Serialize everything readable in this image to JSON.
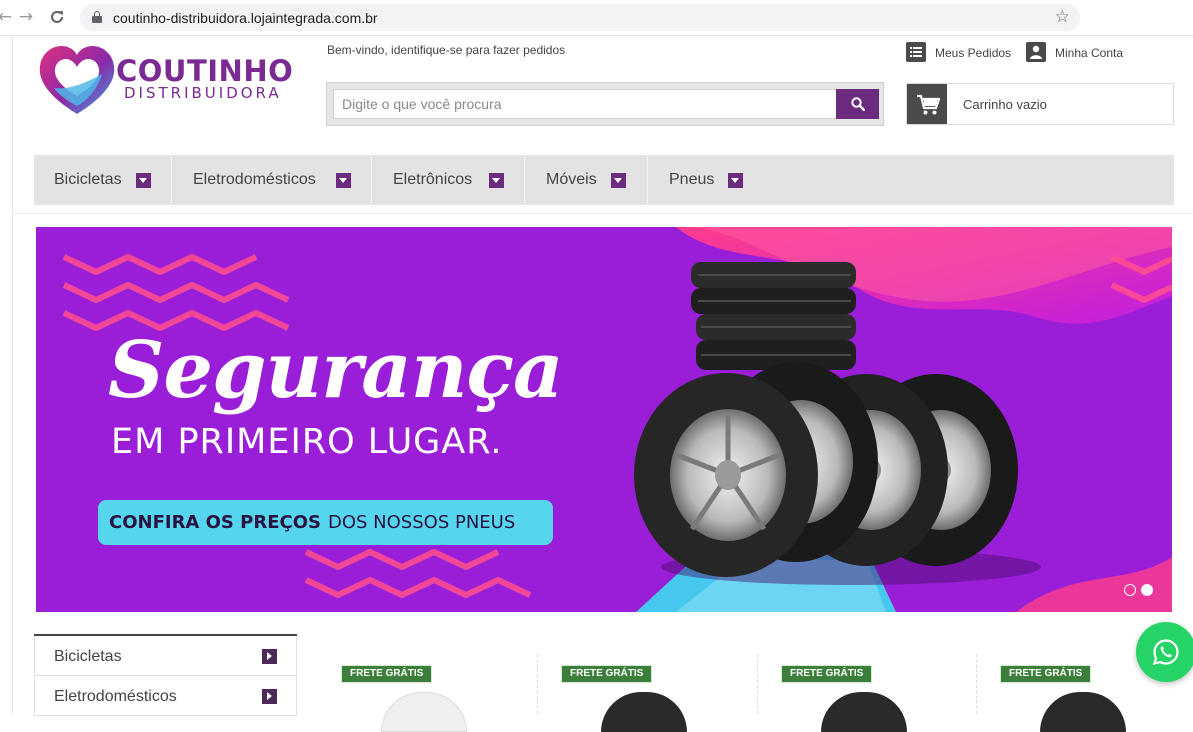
{
  "browser": {
    "url": "coutinho-distribuidora.lojaintegrada.com.br",
    "back_icon": "arrow-left-icon",
    "forward_icon": "arrow-right-icon",
    "reload_icon": "reload-icon",
    "bookmark_icon": "star-icon"
  },
  "header": {
    "logo_name": "COUTINHO",
    "logo_sub": "DISTRIBUIDORA",
    "welcome": "Bem-vindo, identifique-se para fazer pedidos",
    "search_placeholder": "Digite o que você procura",
    "search_value": "",
    "orders_link": "Meus Pedidos",
    "account_link": "Minha Conta",
    "cart_label": "Carrinho vazio"
  },
  "menu": {
    "items": [
      {
        "label": "Bicicletas"
      },
      {
        "label": "Eletrodomésticos"
      },
      {
        "label": "Eletrônicos"
      },
      {
        "label": "Móveis"
      },
      {
        "label": "Pneus"
      }
    ]
  },
  "banner": {
    "title": "Segurança",
    "subtitle": "EM PRIMEIRO LUGAR.",
    "cta_bold": "CONFIRA OS PREÇOS",
    "cta_rest": "DOS NOSSOS PNEUS",
    "slide_count": 2,
    "active_slide": 2,
    "colors": {
      "background": "#9a1ed8",
      "cta": "#55d6ee",
      "accent_pink": "#ff3d8b"
    }
  },
  "sidebar": {
    "items": [
      {
        "label": "Bicicletas"
      },
      {
        "label": "Eletrodomésticos"
      }
    ]
  },
  "products": [
    {
      "badge": "FRETE GRÁTIS"
    },
    {
      "badge": "FRETE GRÁTIS"
    },
    {
      "badge": "FRETE GRÁTIS"
    },
    {
      "badge": "FRETE GRÁTIS"
    }
  ],
  "colors": {
    "brand_purple": "#6b2b7e",
    "badge_green": "#3b7f3a",
    "whatsapp": "#25d366"
  },
  "whatsapp_icon": "whatsapp-icon"
}
